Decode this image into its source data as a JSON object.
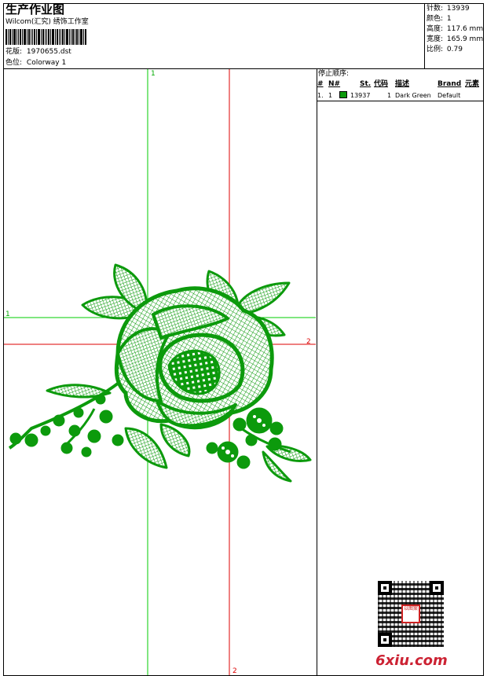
{
  "header": {
    "title": "生产作业图",
    "studio": "Wilcom(汇究) 绣饰工作室",
    "design_label": "花版:",
    "design_value": "1970655.dst",
    "colorway_label": "色位:",
    "colorway_value": "Colorway 1"
  },
  "stats": {
    "stitches_label": "针数:",
    "stitches_value": "13939",
    "colors_label": "颜色:",
    "colors_value": "1",
    "height_label": "高度:",
    "height_value": "117.6 mm",
    "width_label": "宽度:",
    "width_value": "165.9 mm",
    "scale_label": "比例:",
    "scale_value": "0.79"
  },
  "stop_sequence": {
    "title": "停止顺序:",
    "headers": [
      "#",
      "N#",
      "St.",
      "代码",
      "描述",
      "Brand",
      "元素"
    ],
    "rows": [
      {
        "num": "1.",
        "n": "1",
        "color": "#0c9a0c",
        "stitches": "13937",
        "code": "1",
        "desc": "Dark Green",
        "brand": "Default",
        "element": ""
      }
    ]
  },
  "guides": {
    "green_label": "1",
    "red_label": "2",
    "green_color": "#00cc00",
    "red_color": "#dd0000"
  },
  "design_color": "#0c9a0c",
  "watermark": {
    "text": "6xiu.com",
    "stamp_text": "以图案"
  }
}
